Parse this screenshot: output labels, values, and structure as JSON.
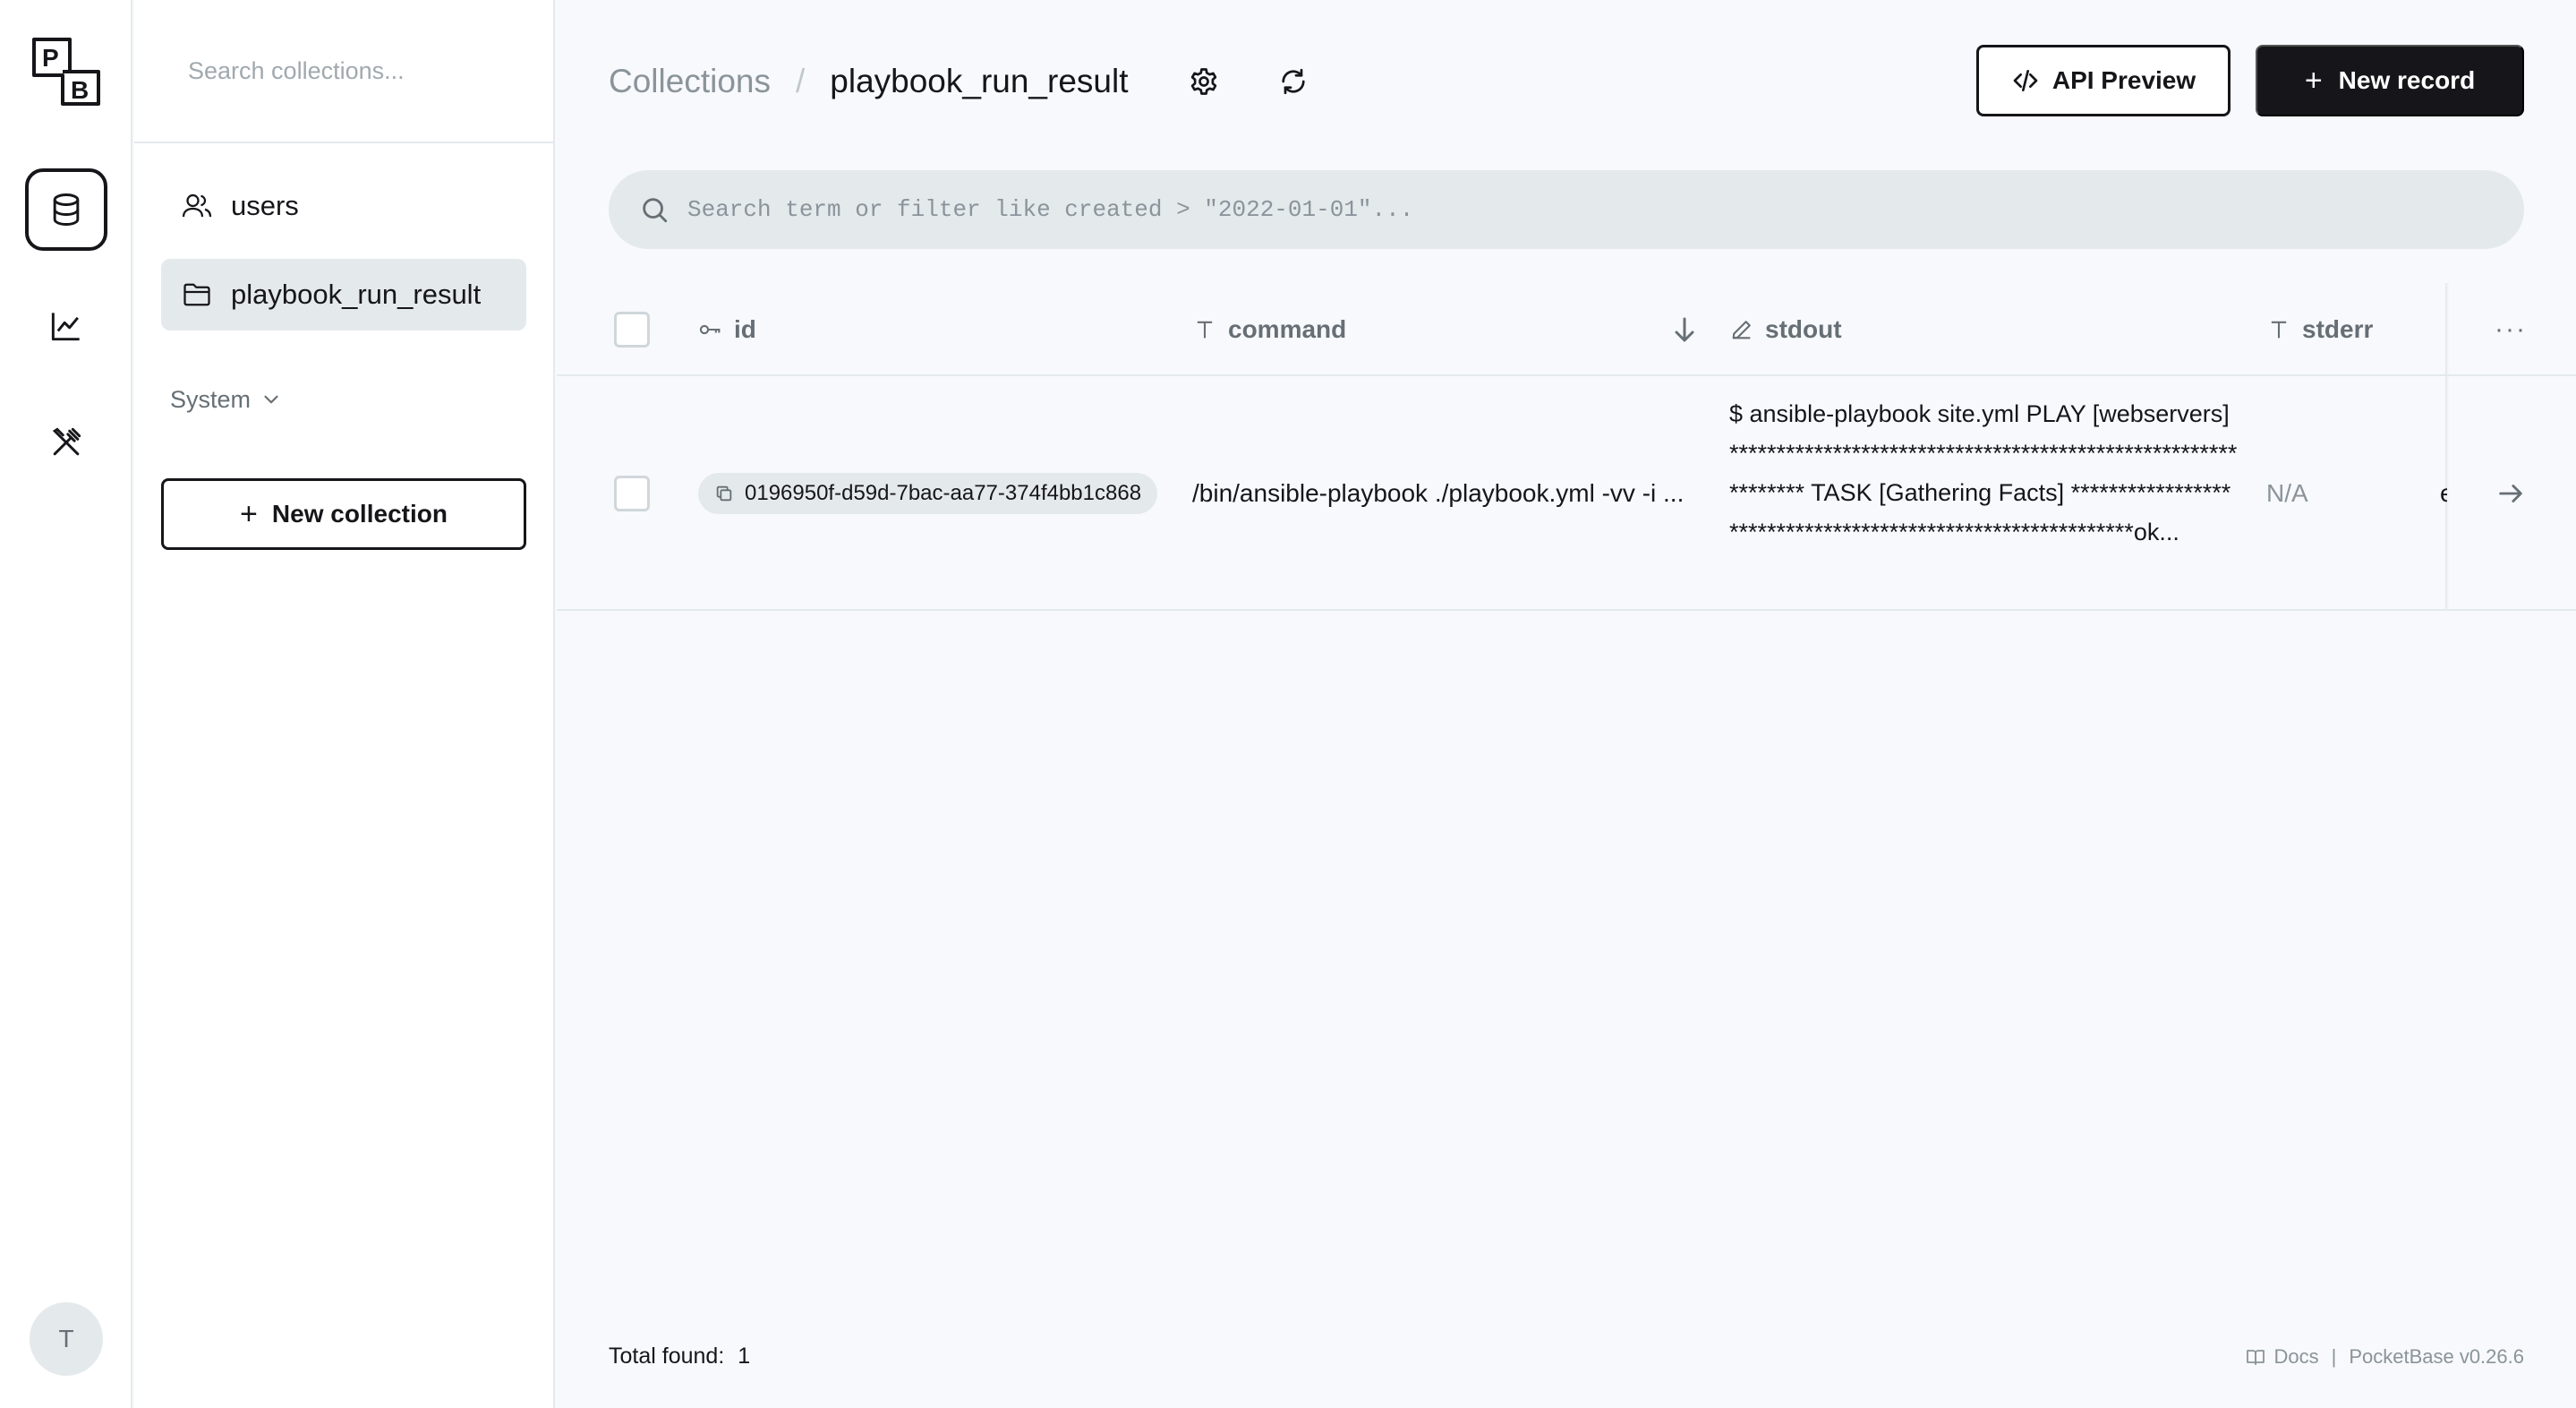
{
  "app": {
    "logo_letters": [
      "P",
      "B"
    ],
    "avatar_initial": "T",
    "nav": [
      {
        "name": "collections",
        "icon": "database-icon",
        "active": true
      },
      {
        "name": "logs",
        "icon": "chart-line-icon",
        "active": false
      },
      {
        "name": "settings",
        "icon": "tools-icon",
        "active": false
      }
    ]
  },
  "sidebar": {
    "search_placeholder": "Search collections...",
    "items": [
      {
        "label": "users",
        "icon": "users-icon",
        "active": false
      },
      {
        "label": "playbook_run_result",
        "icon": "folder-icon",
        "active": true
      }
    ],
    "system_label": "System",
    "new_collection_label": "New collection"
  },
  "header": {
    "breadcrumb_root": "Collections",
    "breadcrumb_sep": "/",
    "collection_name": "playbook_run_result",
    "api_preview_label": "API Preview",
    "new_record_label": "New record"
  },
  "search": {
    "placeholder": "Search term or filter like created > \"2022-01-01\"..."
  },
  "table": {
    "columns": [
      {
        "label": "id",
        "icon": "key-icon"
      },
      {
        "label": "command",
        "icon": "text-icon"
      },
      {
        "label": "stdout",
        "icon": "editor-icon"
      },
      {
        "label": "stderr",
        "icon": "text-icon"
      }
    ],
    "more_label": "···",
    "rows": [
      {
        "id": "0196950f-d59d-7bac-aa77-374f4bb1c868",
        "command": "/bin/ansible-playbook ./playbook.yml -vv -i ...",
        "stdout": "$ ansible-playbook site.yml PLAY [webservers] ************************************************************** TASK [Gathering Facts] ************************************************************ok...",
        "stderr": "N/A",
        "next_col_clip": "e"
      }
    ]
  },
  "footer": {
    "total_label": "Total found:",
    "total_count": "1",
    "docs_label": "Docs",
    "separator": "|",
    "version_label": "PocketBase v0.26.6"
  },
  "colors": {
    "dark": "#16161a",
    "muted": "#8a949a",
    "border": "#e4e9ec",
    "bg": "#f8f9fc"
  }
}
